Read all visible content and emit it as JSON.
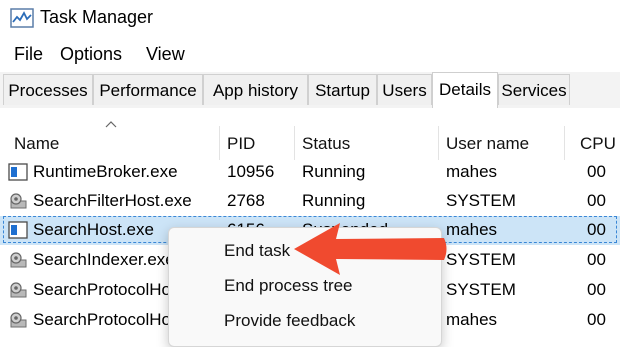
{
  "window": {
    "title": "Task Manager"
  },
  "menubar": [
    "File",
    "Options",
    "View"
  ],
  "tabs": [
    "Processes",
    "Performance",
    "App history",
    "Startup",
    "Users",
    "Details",
    "Services"
  ],
  "active_tab": "Details",
  "table": {
    "columns": [
      "Name",
      "PID",
      "Status",
      "User name",
      "CPU"
    ],
    "rows": [
      {
        "name": "RuntimeBroker.exe",
        "pid": "10956",
        "status": "Running",
        "user": "mahes",
        "cpu": "00",
        "icon": "blue-window-icon"
      },
      {
        "name": "SearchFilterHost.exe",
        "pid": "2768",
        "status": "Running",
        "user": "SYSTEM",
        "cpu": "00",
        "icon": "gear-process-icon"
      },
      {
        "name": "SearchHost.exe",
        "pid": "6156",
        "status": "Suspended",
        "user": "mahes",
        "cpu": "00",
        "icon": "blue-window-icon",
        "selected": true
      },
      {
        "name": "SearchIndexer.exe",
        "pid": "",
        "status": "",
        "user": "SYSTEM",
        "cpu": "00",
        "icon": "gear-process-icon"
      },
      {
        "name": "SearchProtocolHost.exe",
        "pid": "",
        "status": "",
        "user": "SYSTEM",
        "cpu": "00",
        "icon": "gear-process-icon"
      },
      {
        "name": "SearchProtocolHost.exe",
        "pid": "",
        "status": "",
        "user": "mahes",
        "cpu": "00",
        "icon": "gear-process-icon"
      }
    ]
  },
  "context_menu": {
    "items": [
      "End task",
      "End process tree",
      "Provide feedback"
    ]
  },
  "annotation": {
    "color": "#f04a2f"
  }
}
